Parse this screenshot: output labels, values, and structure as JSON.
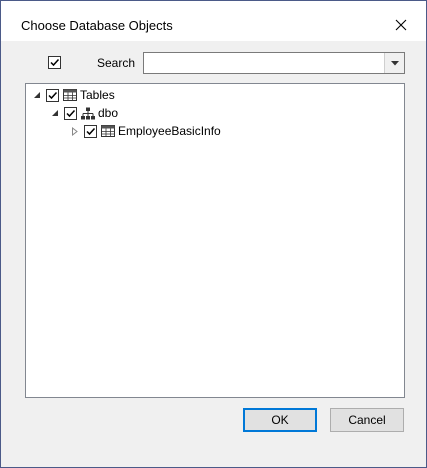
{
  "window": {
    "title": "Choose Database Objects",
    "close_icon": "close-icon"
  },
  "toolbar": {
    "select_all_checked": true,
    "search_label": "Search",
    "search_value": "",
    "search_placeholder": ""
  },
  "tree": {
    "nodes": [
      {
        "label": "Tables",
        "level": 0,
        "expanded": true,
        "checked": true,
        "icon": "table-icon"
      },
      {
        "label": "dbo",
        "level": 1,
        "expanded": true,
        "checked": true,
        "icon": "schema-icon"
      },
      {
        "label": "EmployeeBasicInfo",
        "level": 2,
        "expanded": false,
        "checked": true,
        "icon": "table-icon"
      }
    ]
  },
  "buttons": {
    "ok_label": "OK",
    "cancel_label": "Cancel"
  },
  "colors": {
    "desktop": "#4b5a88",
    "accent": "#0078d7"
  }
}
